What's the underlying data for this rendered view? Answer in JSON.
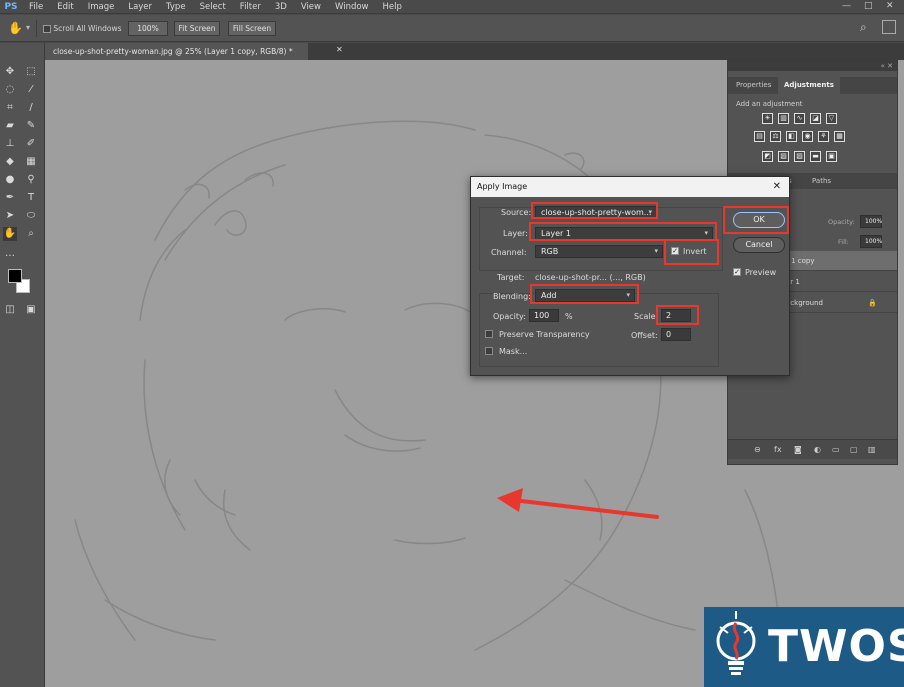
{
  "app": {
    "logo_text": "PS",
    "menu": [
      "File",
      "Edit",
      "Image",
      "Layer",
      "Type",
      "Select",
      "Filter",
      "3D",
      "View",
      "Window",
      "Help"
    ],
    "window_controls": [
      "—",
      "□",
      "✕"
    ]
  },
  "options_bar": {
    "scroll_all_windows": "Scroll All Windows",
    "zoom_button": "100%",
    "fit_screen": "Fit Screen",
    "fill_screen": "Fill Screen"
  },
  "document": {
    "tab_title": "close-up-shot-pretty-woman.jpg @ 25% (Layer 1 copy, RGB/8) *",
    "tab_close": "✕"
  },
  "panels": {
    "tabs": [
      "Properties",
      "Adjustments"
    ],
    "active_tab": "Adjustments",
    "add_adjustment": "Add an adjustment",
    "layer_tabs": [
      "ls",
      "Paths"
    ],
    "opacity_label": "Opacity:",
    "opacity_value": "100%",
    "fill_label": "Fill:",
    "fill_value": "100%",
    "layers": [
      "r 1 copy",
      "er 1",
      "ackground"
    ]
  },
  "dialog": {
    "title": "Apply Image",
    "close": "✕",
    "source_label": "Source:",
    "source_value": "close-up-shot-pretty-wom...",
    "layer_label": "Layer:",
    "layer_value": "Layer 1",
    "channel_label": "Channel:",
    "channel_value": "RGB",
    "invert_label": "Invert",
    "invert_checked": true,
    "target_label": "Target:",
    "target_value": "close-up-shot-pr... (..., RGB)",
    "blending_label": "Blending:",
    "blending_value": "Add",
    "opacity_label": "Opacity:",
    "opacity_value": "100",
    "opacity_unit": "%",
    "scale_label": "Scale:",
    "scale_value": "2",
    "offset_label": "Offset:",
    "offset_value": "0",
    "preserve_transparency": "Preserve Transparency",
    "mask": "Mask...",
    "ok": "OK",
    "cancel": "Cancel",
    "preview": "Preview",
    "preview_checked": true
  },
  "watermark": {
    "text": "TWOS"
  },
  "colors": {
    "highlight": "#e8372c",
    "arrow": "#e8372c",
    "logo_bg": "#1d5a86",
    "canvas": "#9e9e9e"
  }
}
